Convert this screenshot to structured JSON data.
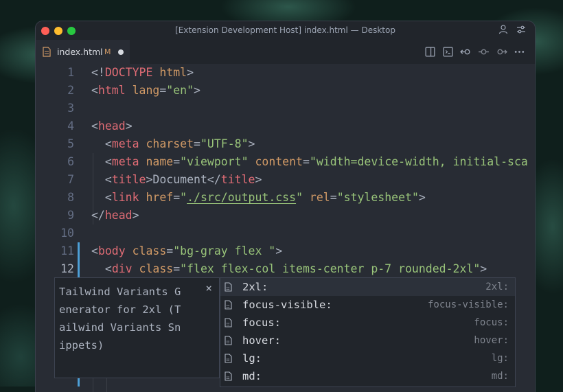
{
  "window": {
    "title": "[Extension Development Host] index.html — Desktop"
  },
  "tab": {
    "name": "index.html",
    "status": "M"
  },
  "icons": {
    "title": [
      "account-icon",
      "settings-sliders-icon"
    ],
    "editor_actions": [
      "open-preview-icon",
      "split-editor-icon",
      "go-back-icon",
      "git-commit-icon",
      "go-forward-icon",
      "more-actions-icon"
    ]
  },
  "editor": {
    "lines": [
      {
        "num": "1",
        "tokens": [
          {
            "t": "<!",
            "c": "pun"
          },
          {
            "t": "DOCTYPE",
            "c": "tag"
          },
          {
            "t": " html",
            "c": "attr"
          },
          {
            "t": ">",
            "c": "pun"
          }
        ]
      },
      {
        "num": "2",
        "tokens": [
          {
            "t": "<",
            "c": "pun"
          },
          {
            "t": "html",
            "c": "tag"
          },
          {
            "t": " lang",
            "c": "attr"
          },
          {
            "t": "=",
            "c": "pun"
          },
          {
            "t": "\"en\"",
            "c": "str"
          },
          {
            "t": ">",
            "c": "pun"
          }
        ]
      },
      {
        "num": "3",
        "tokens": []
      },
      {
        "num": "4",
        "tokens": [
          {
            "t": "<",
            "c": "pun"
          },
          {
            "t": "head",
            "c": "tag"
          },
          {
            "t": ">",
            "c": "pun"
          }
        ]
      },
      {
        "num": "5",
        "tokens": [
          {
            "t": "  <",
            "c": "pun"
          },
          {
            "t": "meta",
            "c": "tag"
          },
          {
            "t": " charset",
            "c": "attr"
          },
          {
            "t": "=",
            "c": "pun"
          },
          {
            "t": "\"UTF-8\"",
            "c": "str"
          },
          {
            "t": ">",
            "c": "pun"
          }
        ]
      },
      {
        "num": "6",
        "tokens": [
          {
            "t": "  <",
            "c": "pun"
          },
          {
            "t": "meta",
            "c": "tag"
          },
          {
            "t": " name",
            "c": "attr"
          },
          {
            "t": "=",
            "c": "pun"
          },
          {
            "t": "\"viewport\"",
            "c": "str"
          },
          {
            "t": " content",
            "c": "attr"
          },
          {
            "t": "=",
            "c": "pun"
          },
          {
            "t": "\"width=device-width, initial-sca",
            "c": "str"
          }
        ]
      },
      {
        "num": "7",
        "tokens": [
          {
            "t": "  <",
            "c": "pun"
          },
          {
            "t": "title",
            "c": "tag"
          },
          {
            "t": ">Document</",
            "c": "pun"
          },
          {
            "t": "title",
            "c": "tag"
          },
          {
            "t": ">",
            "c": "pun"
          }
        ]
      },
      {
        "num": "8",
        "tokens": [
          {
            "t": "  <",
            "c": "pun"
          },
          {
            "t": "link",
            "c": "tag"
          },
          {
            "t": " href",
            "c": "attr"
          },
          {
            "t": "=",
            "c": "pun"
          },
          {
            "t": "\"",
            "c": "str"
          },
          {
            "t": "./src/output.css",
            "c": "str link"
          },
          {
            "t": "\"",
            "c": "str"
          },
          {
            "t": " rel",
            "c": "attr"
          },
          {
            "t": "=",
            "c": "pun"
          },
          {
            "t": "\"stylesheet\"",
            "c": "str"
          },
          {
            "t": ">",
            "c": "pun"
          }
        ]
      },
      {
        "num": "9",
        "tokens": [
          {
            "t": "</",
            "c": "pun"
          },
          {
            "t": "head",
            "c": "tag"
          },
          {
            "t": ">",
            "c": "pun"
          }
        ]
      },
      {
        "num": "10",
        "tokens": []
      },
      {
        "num": "11",
        "tokens": [
          {
            "t": "<",
            "c": "pun"
          },
          {
            "t": "body",
            "c": "tag"
          },
          {
            "t": " class",
            "c": "attr"
          },
          {
            "t": "=",
            "c": "pun"
          },
          {
            "t": "\"bg-gray flex \"",
            "c": "str"
          },
          {
            "t": ">",
            "c": "pun"
          }
        ]
      },
      {
        "num": "12",
        "tokens": [
          {
            "t": "  <",
            "c": "pun"
          },
          {
            "t": "div",
            "c": "tag"
          },
          {
            "t": " class",
            "c": "attr"
          },
          {
            "t": "=",
            "c": "pun"
          },
          {
            "t": "\"flex flex-col items-center p-7 rounded-2xl\"",
            "c": "str"
          },
          {
            "t": ">",
            "c": "pun"
          }
        ]
      }
    ]
  },
  "details": {
    "text": "Tailwind Variants Generator for 2xl (Tailwind Variants Snippets)",
    "close": "×"
  },
  "suggestions": [
    {
      "label": "2xl:",
      "detail": "2xl:"
    },
    {
      "label": "focus-visible:",
      "detail": "focus-visible:"
    },
    {
      "label": "focus:",
      "detail": "focus:"
    },
    {
      "label": "hover:",
      "detail": "hover:"
    },
    {
      "label": "lg:",
      "detail": "lg:"
    },
    {
      "label": "md:",
      "detail": "md:"
    }
  ],
  "colors": {
    "tag": "#e06c75",
    "attr": "#d19a66",
    "string": "#98c379",
    "modified": "#4d9fd6"
  }
}
